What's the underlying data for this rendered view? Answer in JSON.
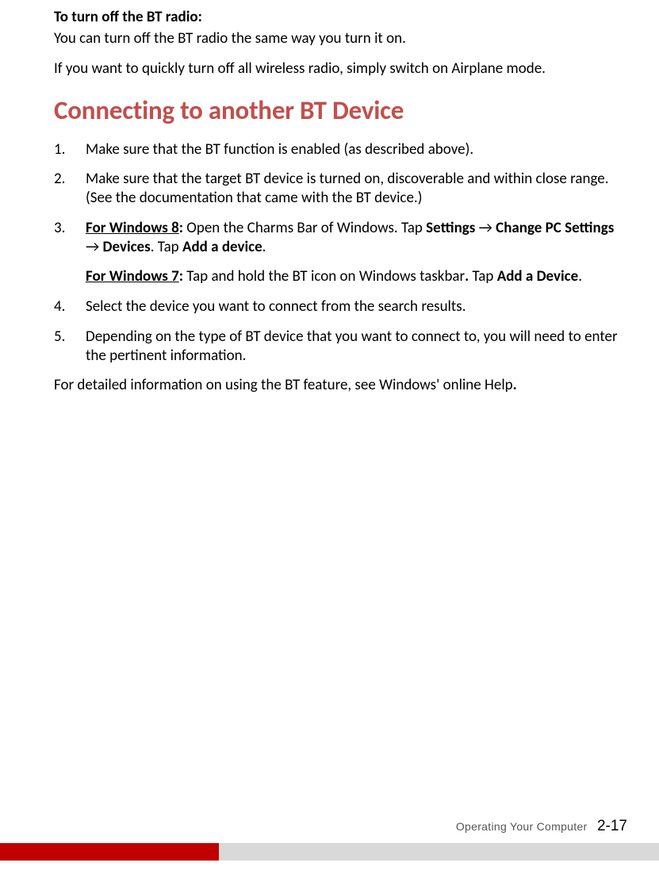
{
  "sub_heading": "To turn off the BT radio:",
  "intro_p1": "You can turn off the BT radio the same way you turn it on.",
  "intro_p2": "If you want to quickly turn off all wireless radio, simply switch on Airplane mode.",
  "section_heading": "Connecting to another BT Device",
  "steps": {
    "s1": "Make sure that the BT function is enabled (as described above).",
    "s2": "Make sure that the target BT device is turned on, discoverable and within close range. (See the documentation that came with the BT device.)",
    "s3_win8_label": "For Windows 8",
    "s3_win8_colon": ":",
    "s3_win8_text_a": " Open the Charms Bar of Windows. Tap ",
    "s3_win8_settings": "Settings",
    "s3_arrow": " → ",
    "s3_win8_change": "Change PC Settings",
    "s3_win8_devices": "Devices",
    "s3_win8_text_b": ". Tap ",
    "s3_win8_add": "Add a device",
    "s3_period": ".",
    "s3_win7_label": "For Windows 7",
    "s3_win7_text_a": " Tap and hold the BT icon on Windows taskbar",
    "s3_win7_dot_bold": ".",
    "s3_win7_text_b": " Tap ",
    "s3_win7_add": "Add a Device",
    "s4": "Select the device you want to connect from the search results.",
    "s5": "Depending on the type of BT device that you want to connect to, you will need to enter the pertinent information."
  },
  "closing": "For detailed information on using the BT feature, see Windows' online Help",
  "closing_dot": ".",
  "footer_section": "Operating Your Computer",
  "footer_page": "2-17"
}
